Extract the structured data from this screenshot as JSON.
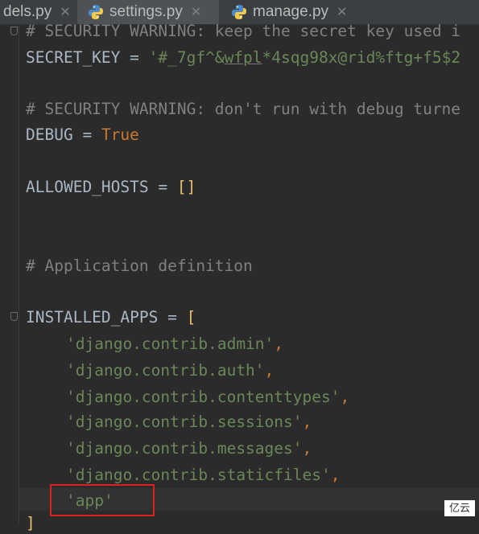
{
  "tabs": [
    {
      "label": "dels.py",
      "icon": "python-file-icon",
      "active": false
    },
    {
      "label": "settings.py",
      "icon": "python-file-icon",
      "active": true
    },
    {
      "label": "manage.py",
      "icon": "python-file-icon",
      "active": false
    }
  ],
  "close_glyph": "✕",
  "code": {
    "line_security_1": "# SECURITY WARNING: keep the secret key used i",
    "secret_key_name": "SECRET_KEY",
    "assign": " = ",
    "secret_key_value_a": "'#_7gf^&",
    "secret_key_value_b": "wfpl",
    "secret_key_value_c": "*4sqg98x@rid%ftg+f5$2",
    "line_security_2": "# SECURITY WARNING: don't run with debug turne",
    "debug_name": "DEBUG",
    "debug_value": "True",
    "allowed_hosts_name": "ALLOWED_HOSTS",
    "allowed_hosts_value": "[]",
    "comment_app_def": "# Application definition",
    "installed_apps_name": "INSTALLED_APPS",
    "open_bracket": "[",
    "apps": [
      "'django.contrib.admin'",
      "'django.contrib.auth'",
      "'django.contrib.contenttypes'",
      "'django.contrib.sessions'",
      "'django.contrib.messages'",
      "'django.contrib.staticfiles'"
    ],
    "comma": ",",
    "new_app": "'app'",
    "close_bracket": "]"
  },
  "watermark": "亿云",
  "colors": {
    "background": "#2b2b2b",
    "comment": "#808080",
    "string": "#6a8759",
    "keyword": "#cc7832",
    "highlight_box": "#e02020"
  }
}
